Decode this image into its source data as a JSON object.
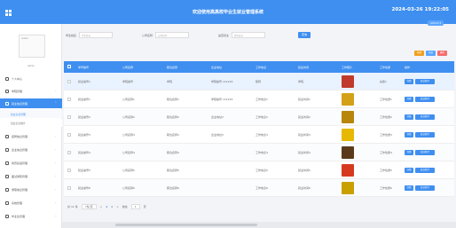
{
  "header": {
    "title": "欢迎使用高高校毕业生就业管理系统",
    "clock": "2024-03-26 19:22:05",
    "admin_label": "admin ▾"
  },
  "sidebar": {
    "avatar_alt": "avatar",
    "user_tag": "admin",
    "items": [
      {
        "label": "个人中心"
      },
      {
        "label": "学院管理"
      },
      {
        "label": "就业信息管理"
      },
      {
        "label": "招聘信息管理"
      },
      {
        "label": "企业信息管理"
      },
      {
        "label": "简历投递管理"
      },
      {
        "label": "面试通知管理"
      },
      {
        "label": "录取信息管理"
      },
      {
        "label": "系统管理"
      },
      {
        "label": "毕业生管理"
      }
    ],
    "sub_items": [
      "就业信息管理",
      "就业信息统计"
    ]
  },
  "search": {
    "field1_label": "学生姓名",
    "field1_placeholder": "学生姓名",
    "field2_label": "公司名称",
    "field2_placeholder": "公司名称",
    "field3_label": "是否就业",
    "field3_placeholder": "是否就业",
    "button": "查询"
  },
  "actions": {
    "add": "新增",
    "export": "导出",
    "delete": "删除"
  },
  "table": {
    "headers": [
      "学号编号",
      "公司名称",
      "职位名称",
      "企业地址",
      "工作地点",
      "就业时间",
      "工作照片",
      "工作性质",
      "操作"
    ],
    "rows": [
      {
        "c1": "就业编号1",
        "c2": "学院编号",
        "c3": "学院",
        "c4": "学院编号 111223",
        "c5": "职称",
        "c6": "学院",
        "c8": "在职1",
        "b1": "详情",
        "b2": "就业简介"
      },
      {
        "c1": "就业编号1",
        "c2": "公司名称1",
        "c3": "职位名称1",
        "c4": "学院编号 111223",
        "c5": "工作地点1",
        "c6": "就业时间1",
        "c8": "工作性质1",
        "b1": "详情",
        "b2": "就业简介"
      },
      {
        "c1": "就业编号2",
        "c2": "公司名称2",
        "c3": "职位名称2",
        "c4": "企业地址2",
        "c5": "工作地点2",
        "c6": "就业时间2",
        "c8": "工作性质2",
        "b1": "详情",
        "b2": "就业简介"
      },
      {
        "c1": "就业编号3",
        "c2": "公司名称3",
        "c3": "职位名称3",
        "c4": "企业地址3",
        "c5": "工作地点3",
        "c6": "就业时间3",
        "c8": "工作性质3",
        "b1": "详情",
        "b2": "就业简介"
      },
      {
        "c1": "就业编号4",
        "c2": "公司名称4",
        "c3": "职位名称4",
        "c4": "",
        "c5": "工作地点4",
        "c6": "就业时间4",
        "c8": "工作性质4",
        "b1": "详情",
        "b2": "就业简介"
      },
      {
        "c1": "就业编号5",
        "c2": "公司名称5",
        "c3": "职位名称5",
        "c4": "",
        "c5": "工作地点5",
        "c6": "就业时间5",
        "c8": "工作性质5",
        "b1": "详情",
        "b2": "就业简介"
      },
      {
        "c1": "就业编号6",
        "c2": "公司名称6",
        "c3": "职位名称6",
        "c4": "",
        "c5": "工作地点6",
        "c6": "就业时间6",
        "c8": "工作性质6",
        "b1": "详情",
        "b2": "就业简介"
      }
    ],
    "thumb_colors": [
      "#c0392b",
      "#d4a017",
      "#b8860b",
      "#e6b800",
      "#5a3a1a",
      "#d63a1e",
      "#c9a000"
    ]
  },
  "pager": {
    "total": "共 11 条",
    "page_size": "7条/页",
    "prev": "<",
    "pages": [
      "1",
      "2"
    ],
    "next": ">",
    "goto_label": "前往",
    "goto_value": "1",
    "goto_suffix": "页"
  },
  "colors": {
    "primary": "#3f8ff0",
    "danger": "#f56c6c",
    "warning": "#f0a020"
  }
}
